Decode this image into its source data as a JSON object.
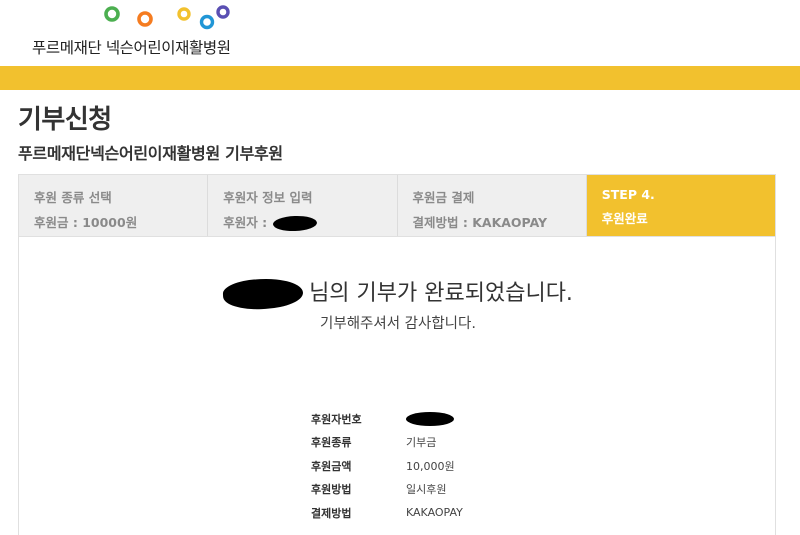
{
  "header": {
    "logo_text": "푸르메재단 넥슨어린이재활병원",
    "logo_dots": [
      {
        "color": "#4caf50"
      },
      {
        "color": "#f57c20"
      },
      {
        "color": "#f2c12e"
      },
      {
        "color": "#2196d6"
      },
      {
        "color": "#5a4fb3"
      }
    ]
  },
  "accent_color": "#f2c12e",
  "page": {
    "title": "기부신청",
    "subtitle": "푸르메재단넥슨어린이재활병원 기부후원"
  },
  "steps": [
    {
      "title": "후원 종류 선택",
      "detail": "후원금 : 10000원",
      "active": false
    },
    {
      "title": "후원자 정보 입력",
      "detail": "후원자 : ",
      "active": false
    },
    {
      "title": "후원금 결제",
      "detail": "결제방법 : KAKAOPAY",
      "active": false
    },
    {
      "title": "STEP 4.",
      "detail": "후원완료",
      "active": true
    }
  ],
  "completion": {
    "message": "님의 기부가 완료되었습니다.",
    "sub_message": "기부해주셔서 감사합니다."
  },
  "summary": [
    {
      "label": "후원자번호",
      "value": ""
    },
    {
      "label": "후원종류",
      "value": "기부금"
    },
    {
      "label": "후원금액",
      "value": "10,000원"
    },
    {
      "label": "후원방법",
      "value": "일시후원"
    },
    {
      "label": "결제방법",
      "value": "KAKAOPAY"
    }
  ]
}
